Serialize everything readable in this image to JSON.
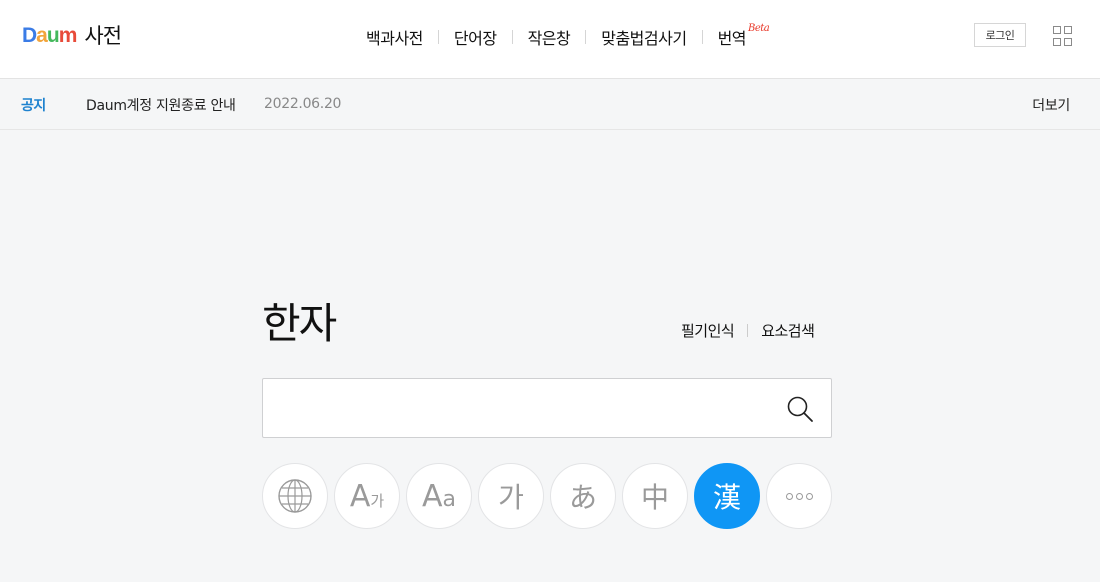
{
  "header": {
    "logo_parts": [
      {
        "ch": "D",
        "color": "#3b7ce6"
      },
      {
        "ch": "a",
        "color": "#f2a53d"
      },
      {
        "ch": "u",
        "color": "#44b85c"
      },
      {
        "ch": "m",
        "color": "#e84b3a"
      }
    ],
    "service_name": "사전",
    "nav": [
      {
        "label": "백과사전"
      },
      {
        "label": "단어장"
      },
      {
        "label": "작은창"
      },
      {
        "label": "맞춤법검사기"
      },
      {
        "label": "번역",
        "badge": "Beta"
      }
    ],
    "login_label": "로그인"
  },
  "notice": {
    "label": "공지",
    "title": "Daum계정 지원종료 안내",
    "date": "2022.06.20",
    "more_label": "더보기"
  },
  "main": {
    "title": "한자",
    "links": [
      "필기인식",
      "요소검색"
    ],
    "search_value": "",
    "dict_buttons": [
      {
        "name": "dict-global-button",
        "icon": "globe-icon",
        "label": ""
      },
      {
        "name": "dict-english-korean-button",
        "icon": "a-ga-icon",
        "label_big": "A",
        "label_small": "가"
      },
      {
        "name": "dict-english-button",
        "icon": "aa-icon",
        "label_big": "A",
        "label_small": "a"
      },
      {
        "name": "dict-korean-button",
        "icon": "ga-icon",
        "label": "가"
      },
      {
        "name": "dict-japanese-button",
        "icon": "a-hiragana-icon",
        "label": "あ"
      },
      {
        "name": "dict-chinese-button",
        "icon": "zhong-icon",
        "label": "中"
      },
      {
        "name": "dict-hanja-button",
        "icon": "han-icon",
        "label": "漢",
        "active": true
      },
      {
        "name": "dict-more-button",
        "icon": "more-icon",
        "label": ""
      }
    ],
    "accent_color": "#0f96f5"
  }
}
